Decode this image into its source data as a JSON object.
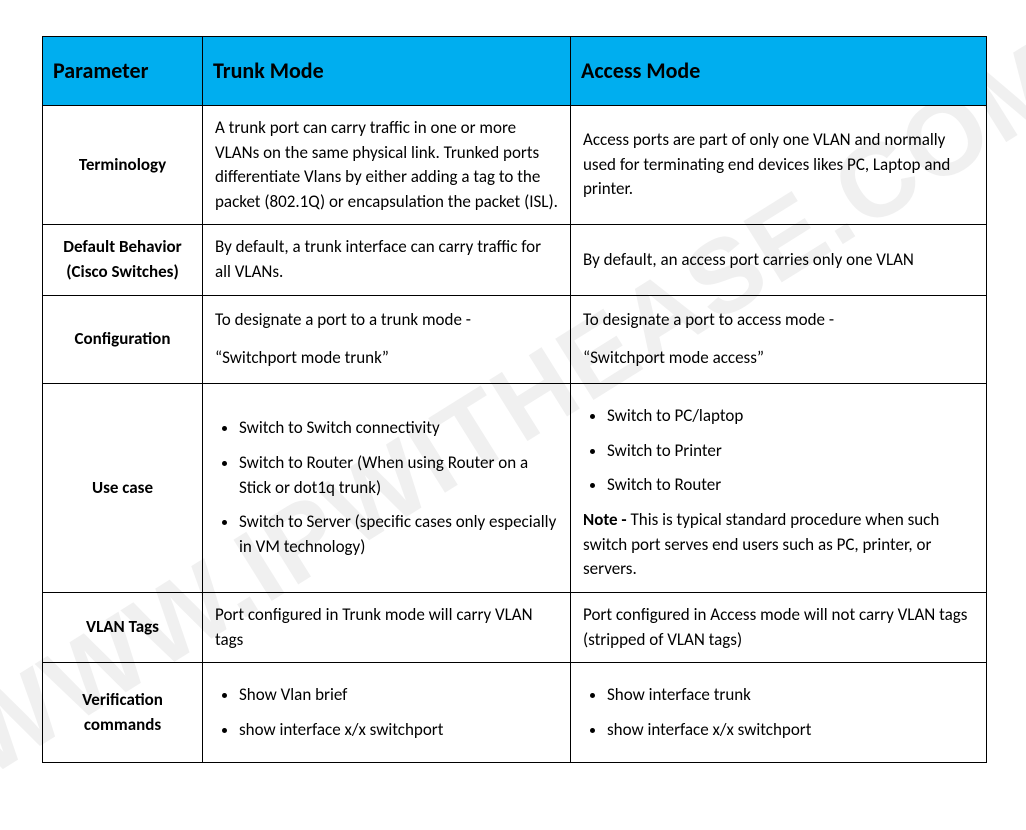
{
  "watermark": "WWW.IPWITHEASE.COM",
  "headers": {
    "parameter": "Parameter",
    "trunk": "Trunk Mode",
    "access": "Access Mode"
  },
  "rows": {
    "terminology": {
      "label": "Terminology",
      "trunk": "A trunk port can carry traffic in one or more VLANs on the same physical link. Trunked ports differentiate Vlans by either adding a tag to the packet (802.1Q) or encapsulation the packet (ISL).",
      "access": "Access ports are part of only one VLAN and normally used for terminating end devices likes PC, Laptop and printer."
    },
    "default_behavior": {
      "label": "Default Behavior (Cisco Switches)",
      "trunk": "By default, a trunk interface can carry traffic for all VLANs.",
      "access": "By default, an access port carries only one VLAN"
    },
    "configuration": {
      "label": "Configuration",
      "trunk_line1": "To designate a port to a trunk mode -",
      "trunk_line2": "“Switchport mode trunk”",
      "access_line1": "To designate a port to access mode -",
      "access_line2": "“Switchport mode access”"
    },
    "use_case": {
      "label": "Use case",
      "trunk_items": [
        "Switch to Switch connectivity",
        "Switch to Router (When using Router on a Stick or dot1q trunk)",
        "Switch to Server (specific cases only especially in VM technology)"
      ],
      "access_items": [
        "Switch to PC/laptop",
        "Switch to Printer",
        "Switch to Router"
      ],
      "access_note_label": "Note - ",
      "access_note_text": "This is typical standard procedure when such switch port serves end users such as PC, printer, or servers."
    },
    "vlan_tags": {
      "label": "VLAN Tags",
      "trunk": "Port configured in Trunk mode will carry VLAN tags",
      "access": "Port configured in Access mode will not carry VLAN tags (stripped of VLAN tags)"
    },
    "verification": {
      "label": "Verification commands",
      "trunk_items": [
        "Show Vlan brief",
        "show interface x/x switchport"
      ],
      "access_items": [
        "Show interface trunk",
        "show interface x/x switchport"
      ]
    }
  }
}
